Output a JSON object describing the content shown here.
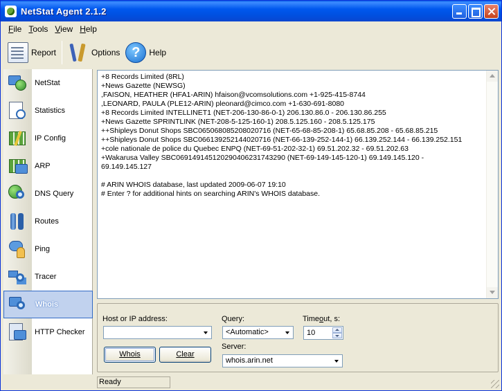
{
  "window": {
    "title": "NetStat Agent 2.1.2"
  },
  "menu": [
    {
      "label": "File",
      "mnemonic": "F",
      "rest": "ile"
    },
    {
      "label": "Tools",
      "mnemonic": "T",
      "rest": "ools"
    },
    {
      "label": "View",
      "mnemonic": "V",
      "rest": "iew"
    },
    {
      "label": "Help",
      "mnemonic": "H",
      "rest": "elp"
    }
  ],
  "toolbar": {
    "report_label": "Report",
    "options_label": "Options",
    "help_label": "Help",
    "report_icon": "report-icon",
    "options_icon": "tools-icon",
    "help_icon": "help-icon"
  },
  "sidebar": {
    "items": [
      {
        "label": "NetStat",
        "icon": "netstat-icon"
      },
      {
        "label": "Statistics",
        "icon": "statistics-icon"
      },
      {
        "label": "IP Config",
        "icon": "ip-config-icon"
      },
      {
        "label": "ARP",
        "icon": "arp-icon"
      },
      {
        "label": "DNS Query",
        "icon": "dns-query-icon"
      },
      {
        "label": "Routes",
        "icon": "routes-icon"
      },
      {
        "label": "Ping",
        "icon": "ping-icon"
      },
      {
        "label": "Tracer",
        "icon": "tracer-icon"
      },
      {
        "label": "Whois",
        "icon": "whois-icon"
      },
      {
        "label": "HTTP Checker",
        "icon": "http-checker-icon"
      }
    ],
    "active": "Whois"
  },
  "output": {
    "lines": [
      "+8 Records Limited (8RL)",
      "+News Gazette (NEWSG)",
      ",FAISON, HEATHER (HFA1-ARIN) hfaison@vcomsolutions.com +1-925-415-8744",
      ",LEONARD, PAULA (PLE12-ARIN) pleonard@cimco.com +1-630-691-8080",
      "+8 Records Limited INTELLINET1 (NET-206-130-86-0-1) 206.130.86.0 - 206.130.86.255",
      "+News Gazette SPRINTLINK (NET-208-5-125-160-1) 208.5.125.160 - 208.5.125.175",
      "++Shipleys Donut Shops SBC065068085208020716 (NET-65-68-85-208-1) 65.68.85.208 - 65.68.85.215",
      "++Shipleys Donut Shops SBC066139252144020716 (NET-66-139-252-144-1) 66.139.252.144 - 66.139.252.151",
      "+cole nationale de police du Quebec ENPQ (NET-69-51-202-32-1) 69.51.202.32 - 69.51.202.63",
      "+Wakarusa Valley SBC069149145120290406231743290 (NET-69-149-145-120-1) 69.149.145.120 -",
      "69.149.145.127",
      "",
      "# ARIN WHOIS database, last updated 2009-06-07 19:10",
      "# Enter ? for additional hints on searching ARIN's WHOIS database."
    ]
  },
  "form": {
    "host_label": "Host or IP address:",
    "host_value": "",
    "query_label": "Query:",
    "query_value": "<Automatic>",
    "timeout_label_pre": "Time",
    "timeout_label_u": "o",
    "timeout_label_post": "ut, s:",
    "timeout_value": "10",
    "server_label": "Server:",
    "server_value": "whois.arin.net",
    "whois_button": "Whois",
    "clear_button": "Clear"
  },
  "status": {
    "text": "Ready"
  },
  "colors": {
    "title_bar": "#0058ee",
    "active_item_bg": "#c1d2ee",
    "window_bg": "#ece9d8"
  }
}
